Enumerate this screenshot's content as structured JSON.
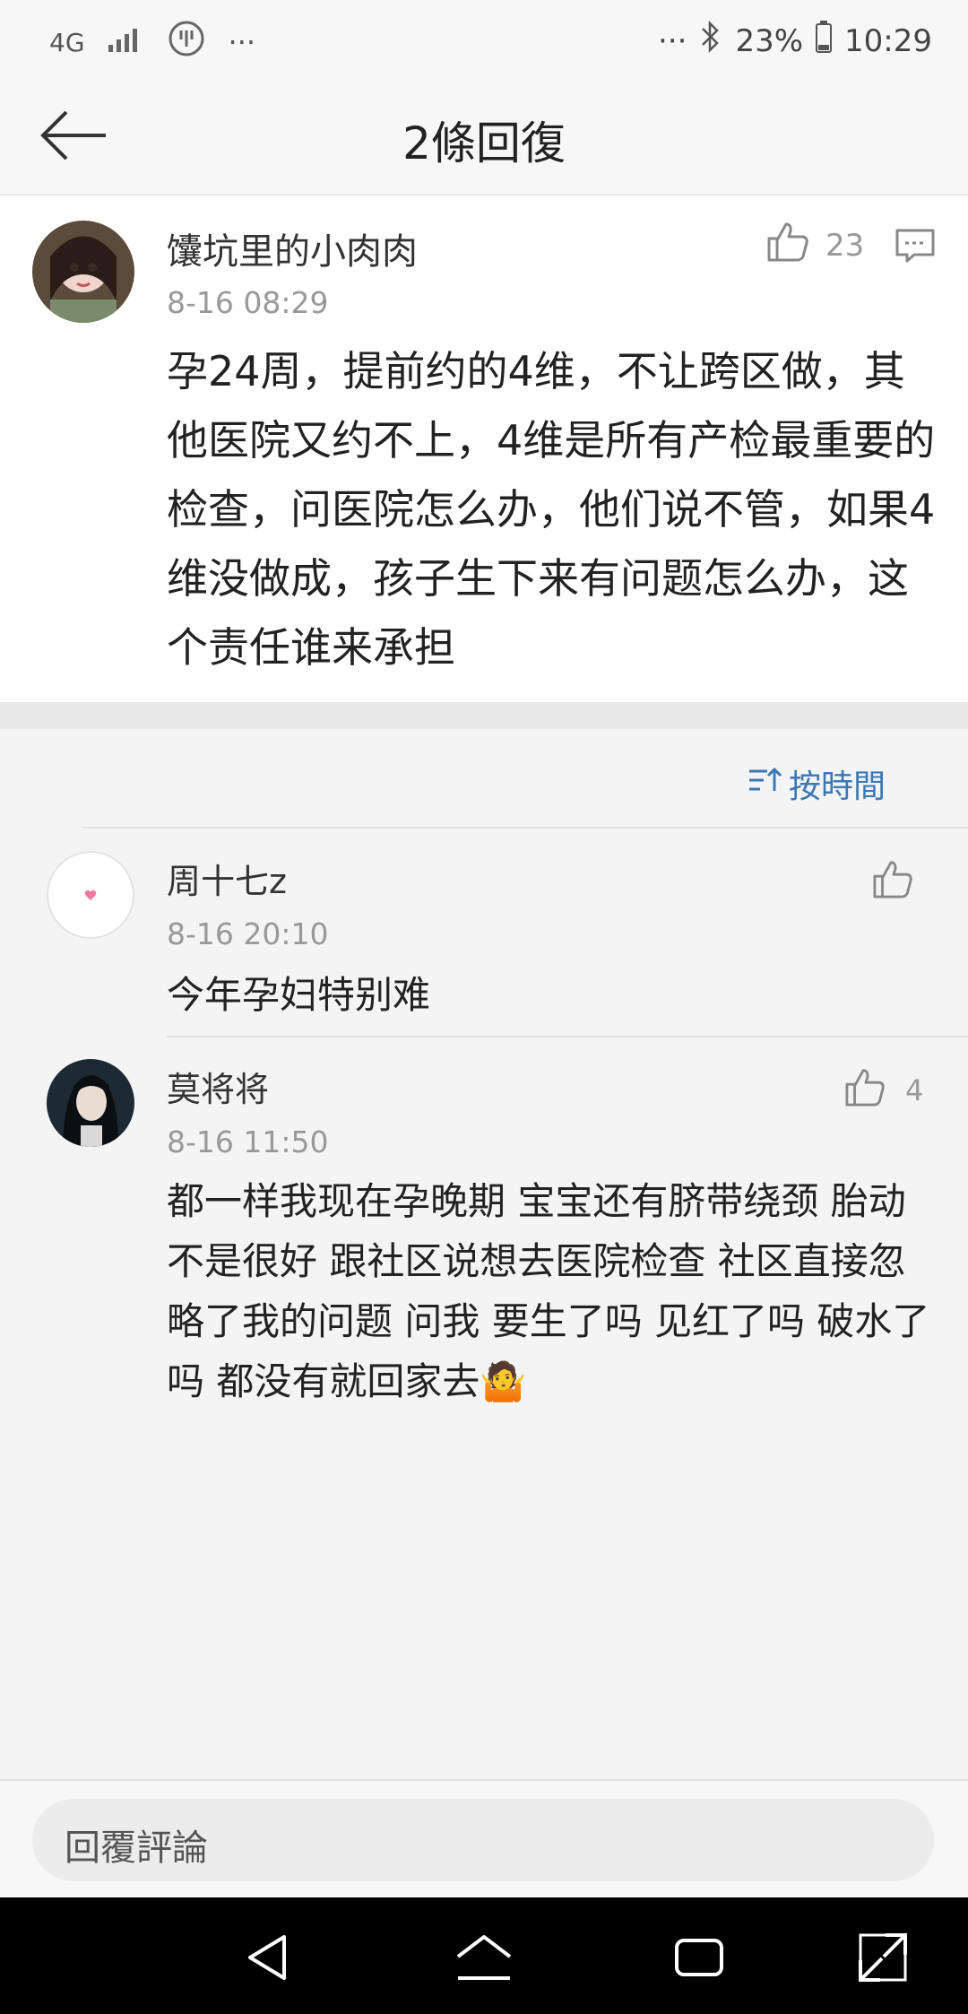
{
  "status_bar": {
    "network": "4G",
    "dots_left": "···",
    "dots_right": "···",
    "battery": "23%",
    "time": "10:29"
  },
  "header": {
    "title": "2條回復"
  },
  "main_comment": {
    "author": "馕坑里的小肉肉",
    "time": "8-16 08:29",
    "likes": "23",
    "text": "孕24周，提前约的4维，不让跨区做，其他医院又约不上，4维是所有产检最重要的检查，问医院怎么办，他们说不管，如果4维没做成，孩子生下来有问题怎么办，这个责任谁来承担"
  },
  "sort": {
    "label": "按時間"
  },
  "replies": [
    {
      "author": "周十七z",
      "time": "8-16 20:10",
      "text": "今年孕妇特别难",
      "likes": ""
    },
    {
      "author": "莫将将",
      "time": "8-16 11:50",
      "text": "都一样我现在孕晚期 宝宝还有脐带绕颈 胎动不是很好 跟社区说想去医院检查 社区直接忽略了我的问题 问我 要生了吗 见红了吗 破水了吗 都没有就回家去🤷",
      "likes": "4"
    }
  ],
  "reply_input": {
    "placeholder": "回覆評論"
  },
  "colors": {
    "accent": "#3a78b6",
    "muted": "#999999",
    "background": "#f4f4f5"
  }
}
